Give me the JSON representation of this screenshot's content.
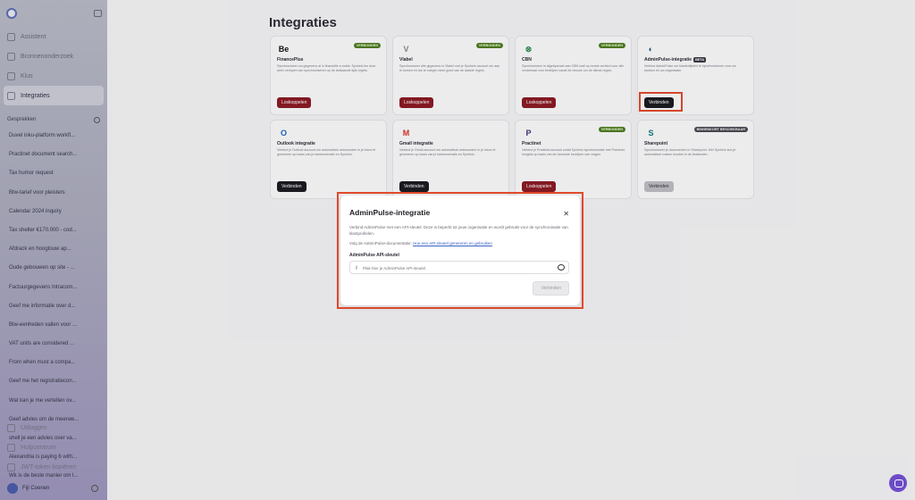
{
  "sidebar": {
    "nav": [
      {
        "label": "Assistent",
        "icon": "chat-icon"
      },
      {
        "label": "Bronnenonderzoek",
        "icon": "search-icon"
      },
      {
        "label": "Klus",
        "icon": "close-icon"
      },
      {
        "label": "Integraties",
        "icon": "plug-icon"
      }
    ],
    "conversations_header": "Gesprekken",
    "conversations": [
      "Duvel inku-platform workfl...",
      "Practinet document search...",
      "Tax humor request",
      "Btw-tarief voor pleisters",
      "Calendar 2024 inquiry",
      "Tax shelter €170.000 - cod...",
      "Afdrack en hoogtouw ap...",
      "Oude gebouwen op site - ...",
      "Factuurgegevens Intracom...",
      "Geef me informatie over d...",
      "Btw-eenheden vallen voor ...",
      "VAT units are considered ...",
      "From when must a compa...",
      "Geef me het registratiecon...",
      "Wat kan je me vertellen ov...",
      "Geef advies om de meerwe...",
      "shell je een advies over va...",
      "Alexandria is paying 6 with...",
      "Wk is de beste manier om l..."
    ],
    "bottom_nav": [
      {
        "label": "Uitloggen",
        "icon": "logout-icon"
      },
      {
        "label": "Hulpcentrum",
        "icon": "help-icon"
      },
      {
        "label": "JWT-token kopiëren",
        "icon": "copy-icon"
      }
    ],
    "user": "Fijl Coenen"
  },
  "main": {
    "title": "Integraties",
    "cards": [
      {
        "name": "FinancePlus",
        "badge": "VERBONDEN",
        "desc": "Synchroniseer uw gegevens al in financiële e-mails. Synhelo leu door weer verlopen van synchroniseren op de bestaande tijds regels.",
        "button": "Loskoppelen",
        "btn_style": "red",
        "logo": "Be",
        "logo_color": "#111"
      },
      {
        "name": "Vlabel",
        "badge": "VERBONDEN",
        "desc": "Synchroniseer alle gegevens in Vlabel met je Synhelo account om aan te komen en toe te voegen deze goed van de laatste regels.",
        "button": "Loskoppelen",
        "btn_style": "red",
        "logo": "V",
        "logo_color": "#888"
      },
      {
        "name": "CBN",
        "badge": "VERBONDEN",
        "desc": "Synchroniseer in afgelopende aan CBN mail op eerste verbind voor alle verderhaal voor bedrijven vanaf de nieuwe om de dienst regels.",
        "button": "Loskoppelen",
        "btn_style": "red",
        "logo": "⊗",
        "logo_color": "#2c8a4a"
      },
      {
        "name": "AdminPulse-integratie",
        "badge": "",
        "beta": "BETA",
        "desc": "Verbind AdminPulse om klantenlijsten te synchroniseren voor uw kantoor en uw organisatie.",
        "button": "Verbinden",
        "btn_style": "black",
        "logo": "◐",
        "logo_color": "#1d4f73"
      },
      {
        "name": "Outlook integratie",
        "badge": "",
        "desc": "Verbind je Outlook account om automatisch antwoorden in je inbox te genereren op basis van je kantooremails en Synhelo.",
        "button": "Verbinden",
        "btn_style": "black",
        "logo": "O",
        "logo_color": "#1a66c4"
      },
      {
        "name": "Gmail integratie",
        "badge": "",
        "desc": "Verbind je Gmail-account om automatisch antwoorden in je inbox te genereren op basis van je kantooremails en Synhelo.",
        "button": "Verbinden",
        "btn_style": "black",
        "logo": "M",
        "logo_color": "#d93025"
      },
      {
        "name": "Practinet",
        "badge": "VERBONDEN",
        "desc": "Verbind je Practinet-account zodat Synhelo synchronisatie met Practinet Insights op basis van de nieuwste bedrijven van vragen.",
        "button": "Loskoppelen",
        "btn_style": "red",
        "logo": "P",
        "logo_color": "#4a2f7a"
      },
      {
        "name": "Sharepoint",
        "badge": "BINNENKORT BESCHIKBAAR",
        "badge_style": "grey",
        "desc": "Synchroniseer je documenten in Sharepoint. Met Synhelo kun je automatisch maken worden in de bestanden.",
        "button": "Verbinden",
        "btn_style": "grey",
        "logo": "S",
        "logo_color": "#0b7a75"
      }
    ]
  },
  "modal": {
    "title": "AdminPulse-integratie",
    "close": "✕",
    "description": "Verbind AdminPulse met een API-sleutel. Deze is beperkt tot jouw organisatie en wordt gebruikt voor de synchronisatie van klantprofielen.",
    "doc_prefix": "Volg de AdminPulse-documentatie:",
    "doc_link": "Hoe een API-sleutel genereren en gebruiken",
    "field_label": "AdminPulse API-sleutel",
    "field_placeholder": "Plak hier je AdminPulse API-sleutel",
    "submit": "Verbinden"
  }
}
